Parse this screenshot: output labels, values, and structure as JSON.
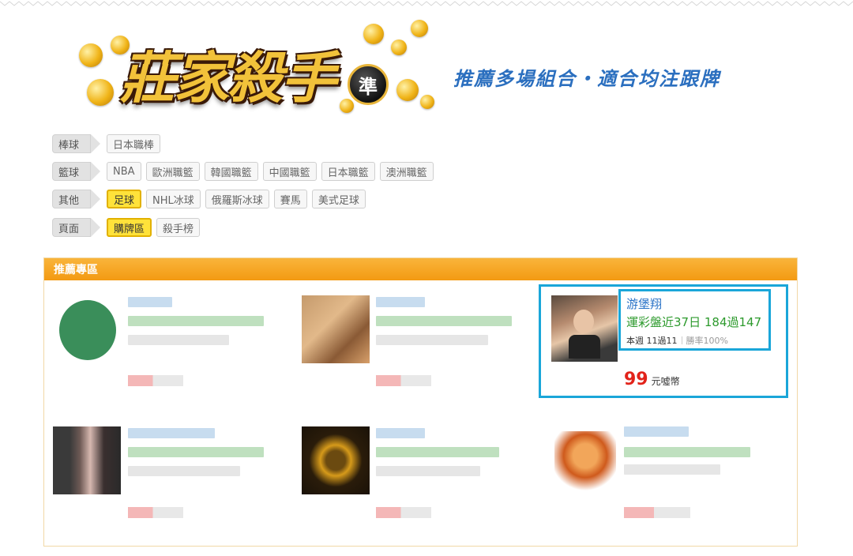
{
  "header": {
    "logo_text": "莊家殺手",
    "logo_badge": "準",
    "slogan": "推薦多場組合・適合均注跟牌"
  },
  "filters": [
    {
      "label": "棒球",
      "chips": [
        {
          "text": "日本職棒",
          "active": false
        }
      ]
    },
    {
      "label": "籃球",
      "chips": [
        {
          "text": "NBA",
          "active": false
        },
        {
          "text": "歐洲職籃",
          "active": false
        },
        {
          "text": "韓國職籃",
          "active": false
        },
        {
          "text": "中國職籃",
          "active": false
        },
        {
          "text": "日本職籃",
          "active": false
        },
        {
          "text": "澳洲職籃",
          "active": false
        }
      ]
    },
    {
      "label": "其他",
      "chips": [
        {
          "text": "足球",
          "active": true
        },
        {
          "text": "NHL冰球",
          "active": false
        },
        {
          "text": "俄羅斯冰球",
          "active": false
        },
        {
          "text": "賽馬",
          "active": false
        },
        {
          "text": "美式足球",
          "active": false
        }
      ]
    },
    {
      "label": "頁面",
      "chips": [
        {
          "text": "購牌區",
          "active": true
        },
        {
          "text": "殺手榜",
          "active": false
        }
      ]
    }
  ],
  "panel": {
    "title": "推薦專區",
    "featured": {
      "name": "游堡翔",
      "record": "運彩盤近37日 184過147",
      "week": "本週 11過11",
      "rate": "勝率100%",
      "price": "99",
      "unit": "元噓幣"
    }
  },
  "colors": {
    "accent_orange": "#f39a12",
    "highlight_blue": "#1aa6d9",
    "name_blue": "#2a73c7",
    "record_green": "#2d9a2d",
    "price_red": "#e2231a",
    "active_yellow": "#ffe23a"
  }
}
